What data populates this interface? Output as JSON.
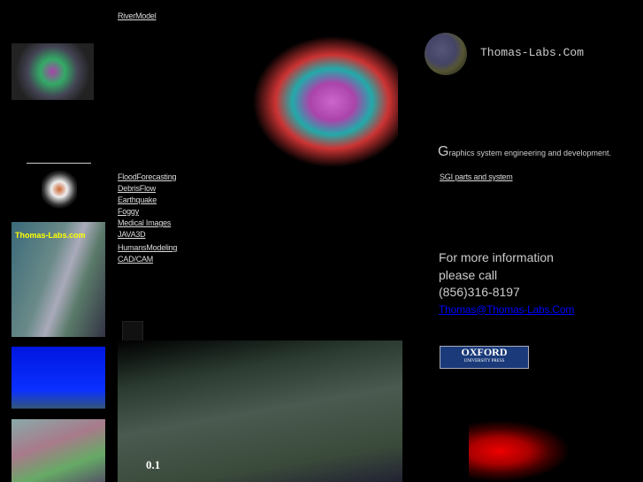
{
  "top_link": "RiverModel",
  "left_links": [
    "FloodForecasting",
    "DebrisFlow",
    "Earthquake",
    "Foggy",
    "Medical Images",
    "JAVA3D"
  ],
  "left_links2": [
    "HumansModeling",
    "CAD/CAM"
  ],
  "logo_text": "Thomas-Labs.Com",
  "tagline_initial": "G",
  "tagline_rest": "raphics system engineering and development.",
  "sgi_link": "SGI parts and system",
  "contact": {
    "line1": "For more information",
    "line2": "please call",
    "phone": "(856)316-8197",
    "email": "Thomas@Thomas-Labs.Com"
  },
  "oxford": {
    "name": "OXFORD",
    "sub": "UNIVERSITY PRESS"
  },
  "thumb_label": "Thomas-Labs.com",
  "scale_label": "0.1"
}
